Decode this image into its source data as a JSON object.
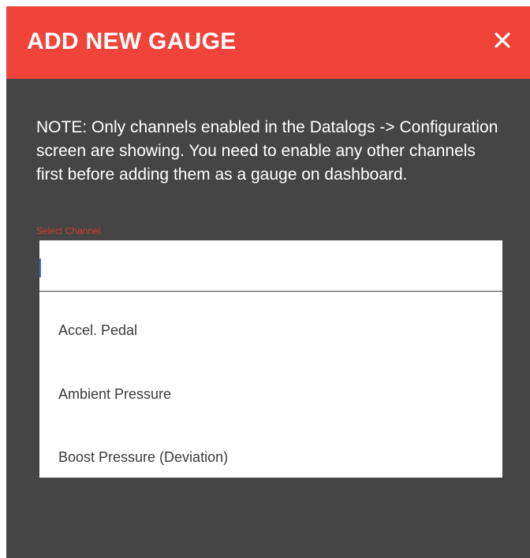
{
  "dialog": {
    "title": "ADD NEW GAUGE",
    "close_icon": "close-icon",
    "note": "NOTE: Only channels enabled in the Datalogs -> Configuration screen are showing. You need to enable any other channels first before adding them as a gauge on dashboard.",
    "field_label": "Select Channel",
    "input_value": "",
    "options": [
      {
        "label": "Accel. Pedal"
      },
      {
        "label": "Ambient Pressure"
      },
      {
        "label": "Boost Pressure (Deviation)"
      }
    ]
  },
  "colors": {
    "header": "#f0443a",
    "body": "#454545",
    "label_accent": "#d83b30",
    "caret": "#3b6fd4"
  }
}
